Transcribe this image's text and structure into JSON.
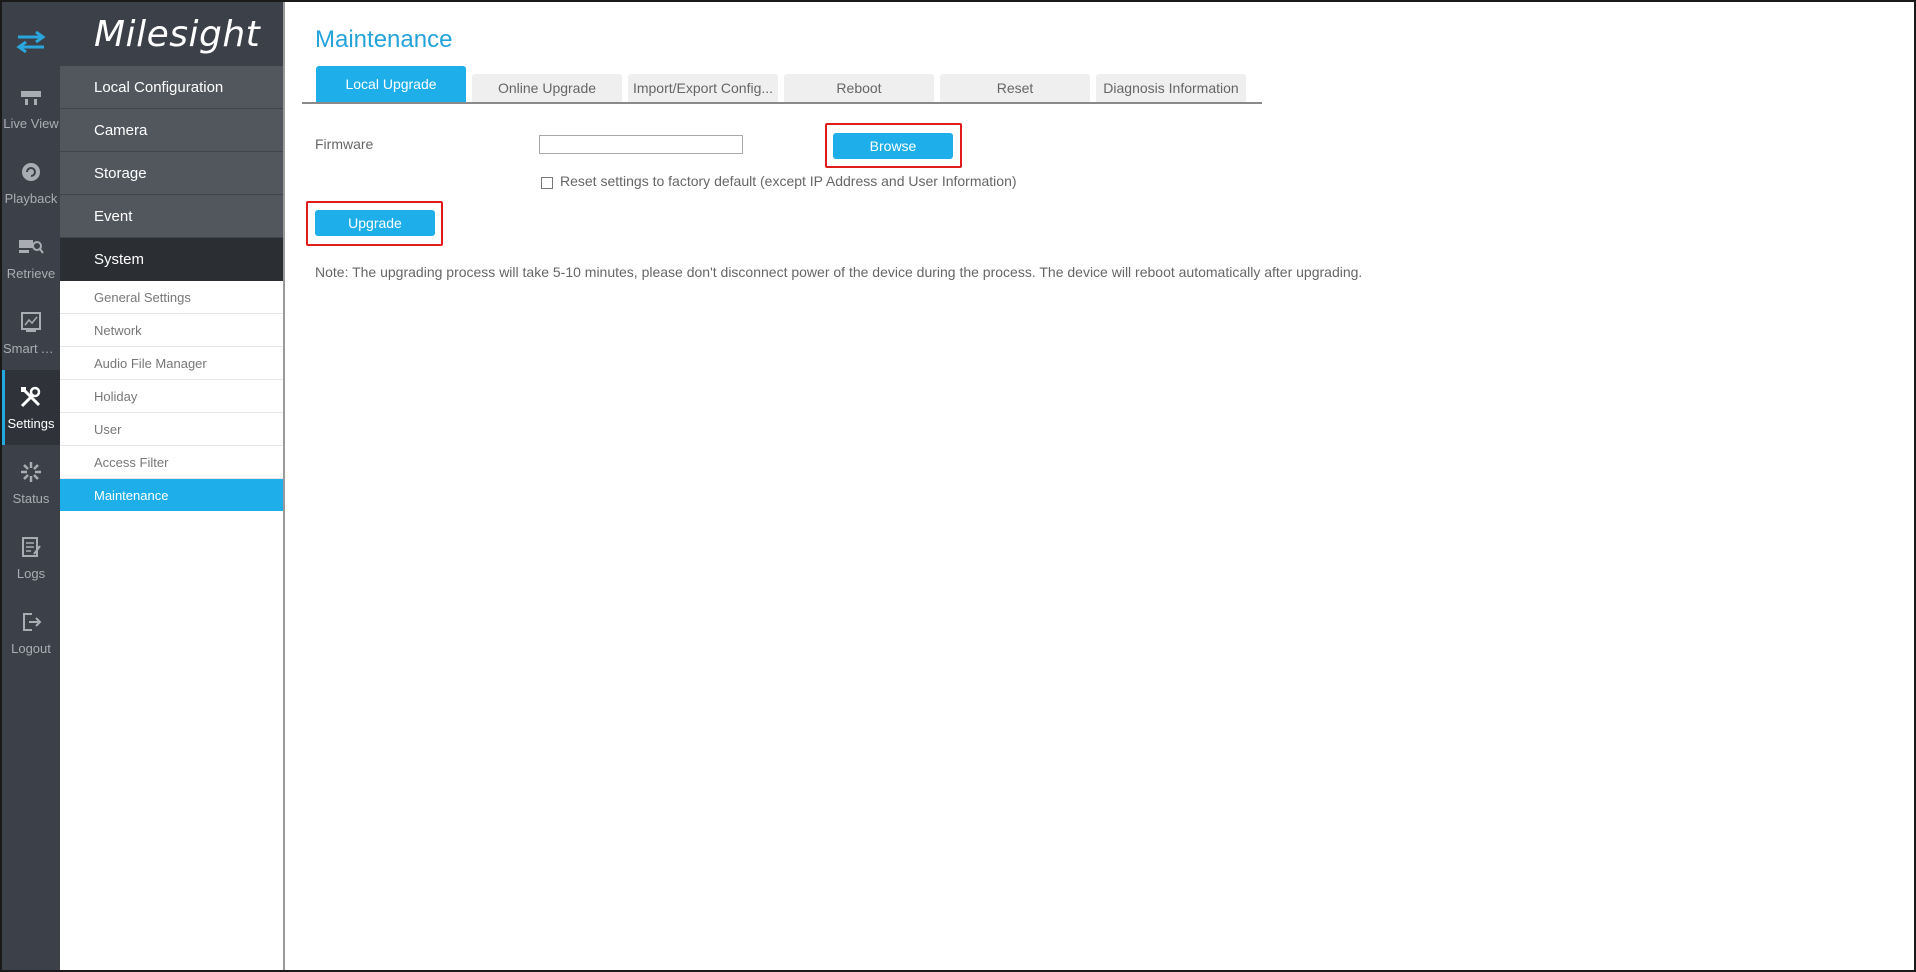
{
  "brand": "Milesight",
  "rail": {
    "items": [
      {
        "label": "Live View",
        "icon": "live-view-icon"
      },
      {
        "label": "Playback",
        "icon": "playback-icon"
      },
      {
        "label": "Retrieve",
        "icon": "retrieve-icon"
      },
      {
        "label": "Smart A...",
        "icon": "smart-analysis-icon"
      },
      {
        "label": "Settings",
        "icon": "settings-icon"
      },
      {
        "label": "Status",
        "icon": "status-icon"
      },
      {
        "label": "Logs",
        "icon": "logs-icon"
      },
      {
        "label": "Logout",
        "icon": "logout-icon"
      }
    ]
  },
  "menu": {
    "main": [
      "Local Configuration",
      "Camera",
      "Storage",
      "Event",
      "System"
    ],
    "sub": [
      "General Settings",
      "Network",
      "Audio File Manager",
      "Holiday",
      "User",
      "Access Filter",
      "Maintenance"
    ]
  },
  "page": {
    "title": "Maintenance",
    "tabs": [
      "Local Upgrade",
      "Online Upgrade",
      "Import/Export Config...",
      "Reboot",
      "Reset",
      "Diagnosis Information"
    ],
    "firmware_label": "Firmware",
    "firmware_value": "",
    "browse_label": "Browse",
    "reset_checkbox_label": "Reset settings to factory default (except IP Address and User Information)",
    "upgrade_label": "Upgrade",
    "note": "Note: The upgrading process will take 5-10 minutes, please don't disconnect power of the device during the process. The device will reboot automatically after upgrading."
  },
  "colors": {
    "accent": "#1eaeea",
    "title": "#24a3db",
    "highlight": "#e21b1b",
    "rail_bg": "#3c4149"
  }
}
